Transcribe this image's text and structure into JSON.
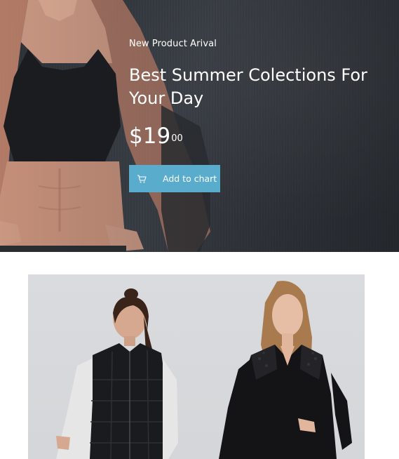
{
  "hero": {
    "eyebrow": "New Product Arival",
    "title": "Best Summer Colections For Your Day",
    "price_currency": "$",
    "price_whole": "19",
    "price_cents": "00",
    "cta_label": "Add to chart",
    "cta_icon": "cart-icon",
    "cta_color": "#5aaccc",
    "background_color": "#33383e"
  },
  "product_image": {
    "background_color": "#d7d9dc"
  }
}
